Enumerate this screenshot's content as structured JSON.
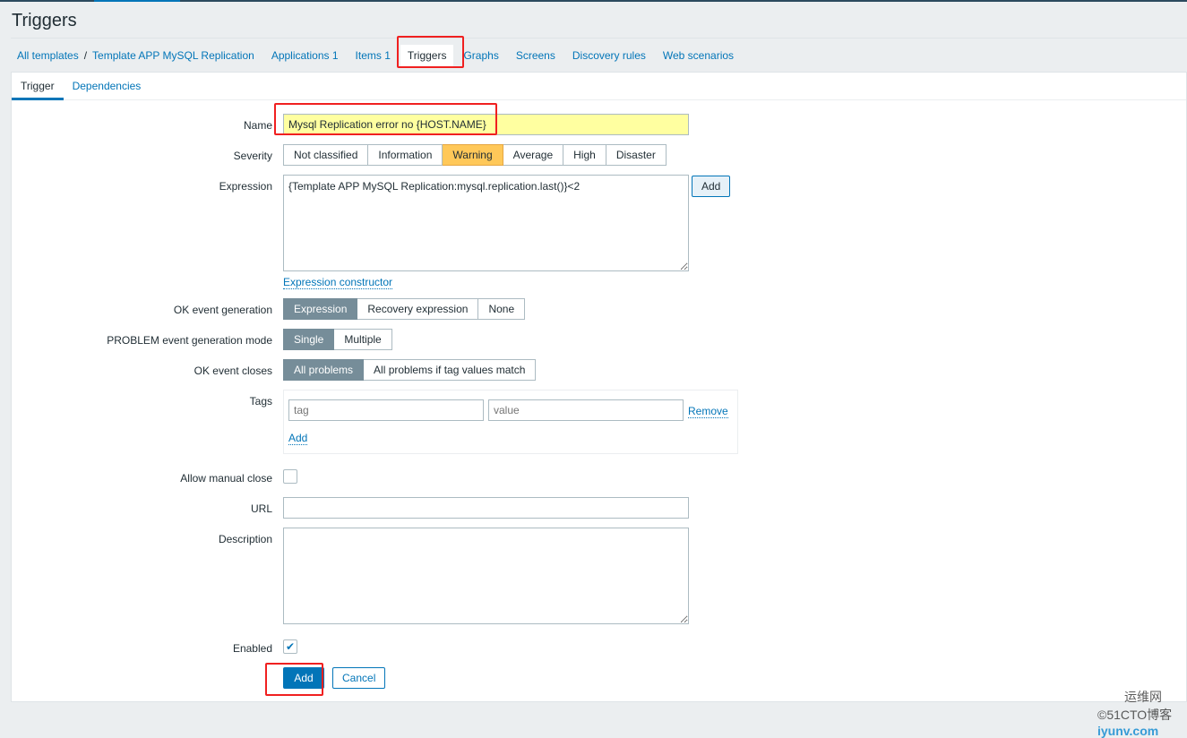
{
  "page": {
    "title": "Triggers"
  },
  "nav": {
    "all_templates": "All templates",
    "separator": "/",
    "template": "Template APP MySQL Replication",
    "items": [
      "Applications 1",
      "Items 1",
      "Triggers",
      "Graphs",
      "Screens",
      "Discovery rules",
      "Web scenarios"
    ]
  },
  "tabs": [
    "Trigger",
    "Dependencies"
  ],
  "form": {
    "name_label": "Name",
    "name_value": "Mysql Replication error no {HOST.NAME}",
    "severity_label": "Severity",
    "severity_options": [
      "Not classified",
      "Information",
      "Warning",
      "Average",
      "High",
      "Disaster"
    ],
    "severity_selected": "Warning",
    "expression_label": "Expression",
    "expression_value": "{Template APP MySQL Replication:mysql.replication.last()}<2",
    "expression_add": "Add",
    "expression_constructor": "Expression constructor",
    "ok_event_label": "OK event generation",
    "ok_event_options": [
      "Expression",
      "Recovery expression",
      "None"
    ],
    "problem_mode_label": "PROBLEM event generation mode",
    "problem_mode_options": [
      "Single",
      "Multiple"
    ],
    "ok_closes_label": "OK event closes",
    "ok_closes_options": [
      "All problems",
      "All problems if tag values match"
    ],
    "tags_label": "Tags",
    "tag_placeholder": "tag",
    "value_placeholder": "value",
    "remove": "Remove",
    "tags_add": "Add",
    "manual_close_label": "Allow manual close",
    "manual_close": false,
    "url_label": "URL",
    "url_value": "",
    "description_label": "Description",
    "description_value": "",
    "enabled_label": "Enabled",
    "enabled": true,
    "add_button": "Add",
    "cancel_button": "Cancel"
  },
  "watermark": {
    "text1": "运维网",
    "text2": "©51CTO博客",
    "text3": "iyunv.com"
  },
  "colors": {
    "accent": "#0275b8",
    "warning": "#ffc859",
    "selected": "#768d99",
    "highlight": "#f02020"
  }
}
